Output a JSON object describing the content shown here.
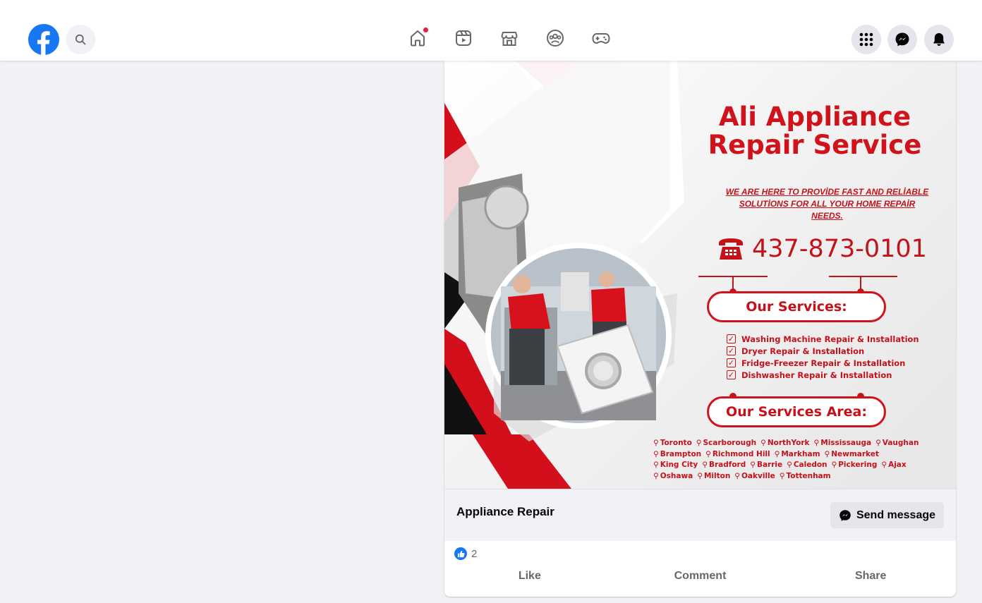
{
  "topbar": {
    "nav_icons": [
      "home-icon",
      "reels-icon",
      "marketplace-icon",
      "groups-icon",
      "gaming-icon"
    ],
    "right_icons": [
      "menu-grid-icon",
      "messenger-icon",
      "bell-icon"
    ],
    "brand_color": "#1877f2"
  },
  "post": {
    "image": {
      "title": "Ali Appliance\nRepair Service",
      "tagline": "WE ARE HERE TO PROVİDE FAST AND RELİABLE SOLUTİONS FOR ALL YOUR HOME REPAİR NEEDS.",
      "phone": "437-873-0101",
      "services_heading": "Our Services:",
      "services": [
        "Washing Machine Repair & Installation",
        "Dryer Repair & Installation",
        "Fridge-Freezer Repair & Installation",
        "Dishwasher Repair & Installation"
      ],
      "area_heading": "Our Services Area:",
      "areas": [
        [
          "Toronto",
          "Scarborough",
          "NorthYork",
          "Mississauga",
          "Vaughan"
        ],
        [
          "Brampton",
          "Richmond Hill",
          "Markham",
          "Newmarket"
        ],
        [
          "King City",
          "Bradford",
          "Barrie",
          "Caledon",
          "Pickering",
          "Ajax"
        ],
        [
          "Oshawa",
          "Milton",
          "Oakville",
          "Tottenham"
        ]
      ],
      "accent_color": "#d0121b"
    },
    "caption_title": "Appliance Repair",
    "send_button": "Send message",
    "reaction_count": "2",
    "actions": {
      "like": "Like",
      "comment": "Comment",
      "share": "Share"
    }
  }
}
